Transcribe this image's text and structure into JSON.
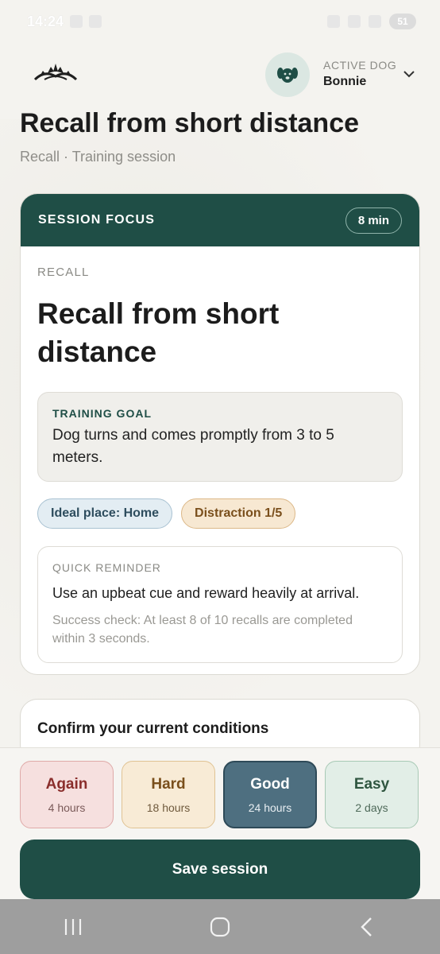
{
  "status": {
    "time": "14:24",
    "battery": "51"
  },
  "header": {
    "active_dog_label": "ACTIVE DOG",
    "active_dog_name": "Bonnie"
  },
  "page": {
    "title": "Recall from short distance",
    "breadcrumb": "Recall · Training session"
  },
  "focus": {
    "heading": "SESSION FOCUS",
    "duration": "8 min",
    "category": "RECALL",
    "exercise_title": "Recall from short distance",
    "goal_label": "TRAINING GOAL",
    "goal_text": "Dog turns and comes promptly from 3 to 5 meters.",
    "chip_place": "Ideal place: Home",
    "chip_distraction": "Distraction 1/5",
    "reminder_label": "QUICK REMINDER",
    "reminder_text": "Use an upbeat cue and reward heavily at arrival.",
    "reminder_sub": "Success check: At least 8 of 10 recalls are completed within 3 seconds."
  },
  "conditions": {
    "title": "Confirm your current conditions"
  },
  "grades": [
    {
      "name": "Again",
      "time": "4 hours"
    },
    {
      "name": "Hard",
      "time": "18 hours"
    },
    {
      "name": "Good",
      "time": "24 hours"
    },
    {
      "name": "Easy",
      "time": "2 days"
    }
  ],
  "save_label": "Save session",
  "colors": {
    "primary": "#1f4e46",
    "selected": "#4e6f80",
    "background": "#f4f3ef"
  }
}
